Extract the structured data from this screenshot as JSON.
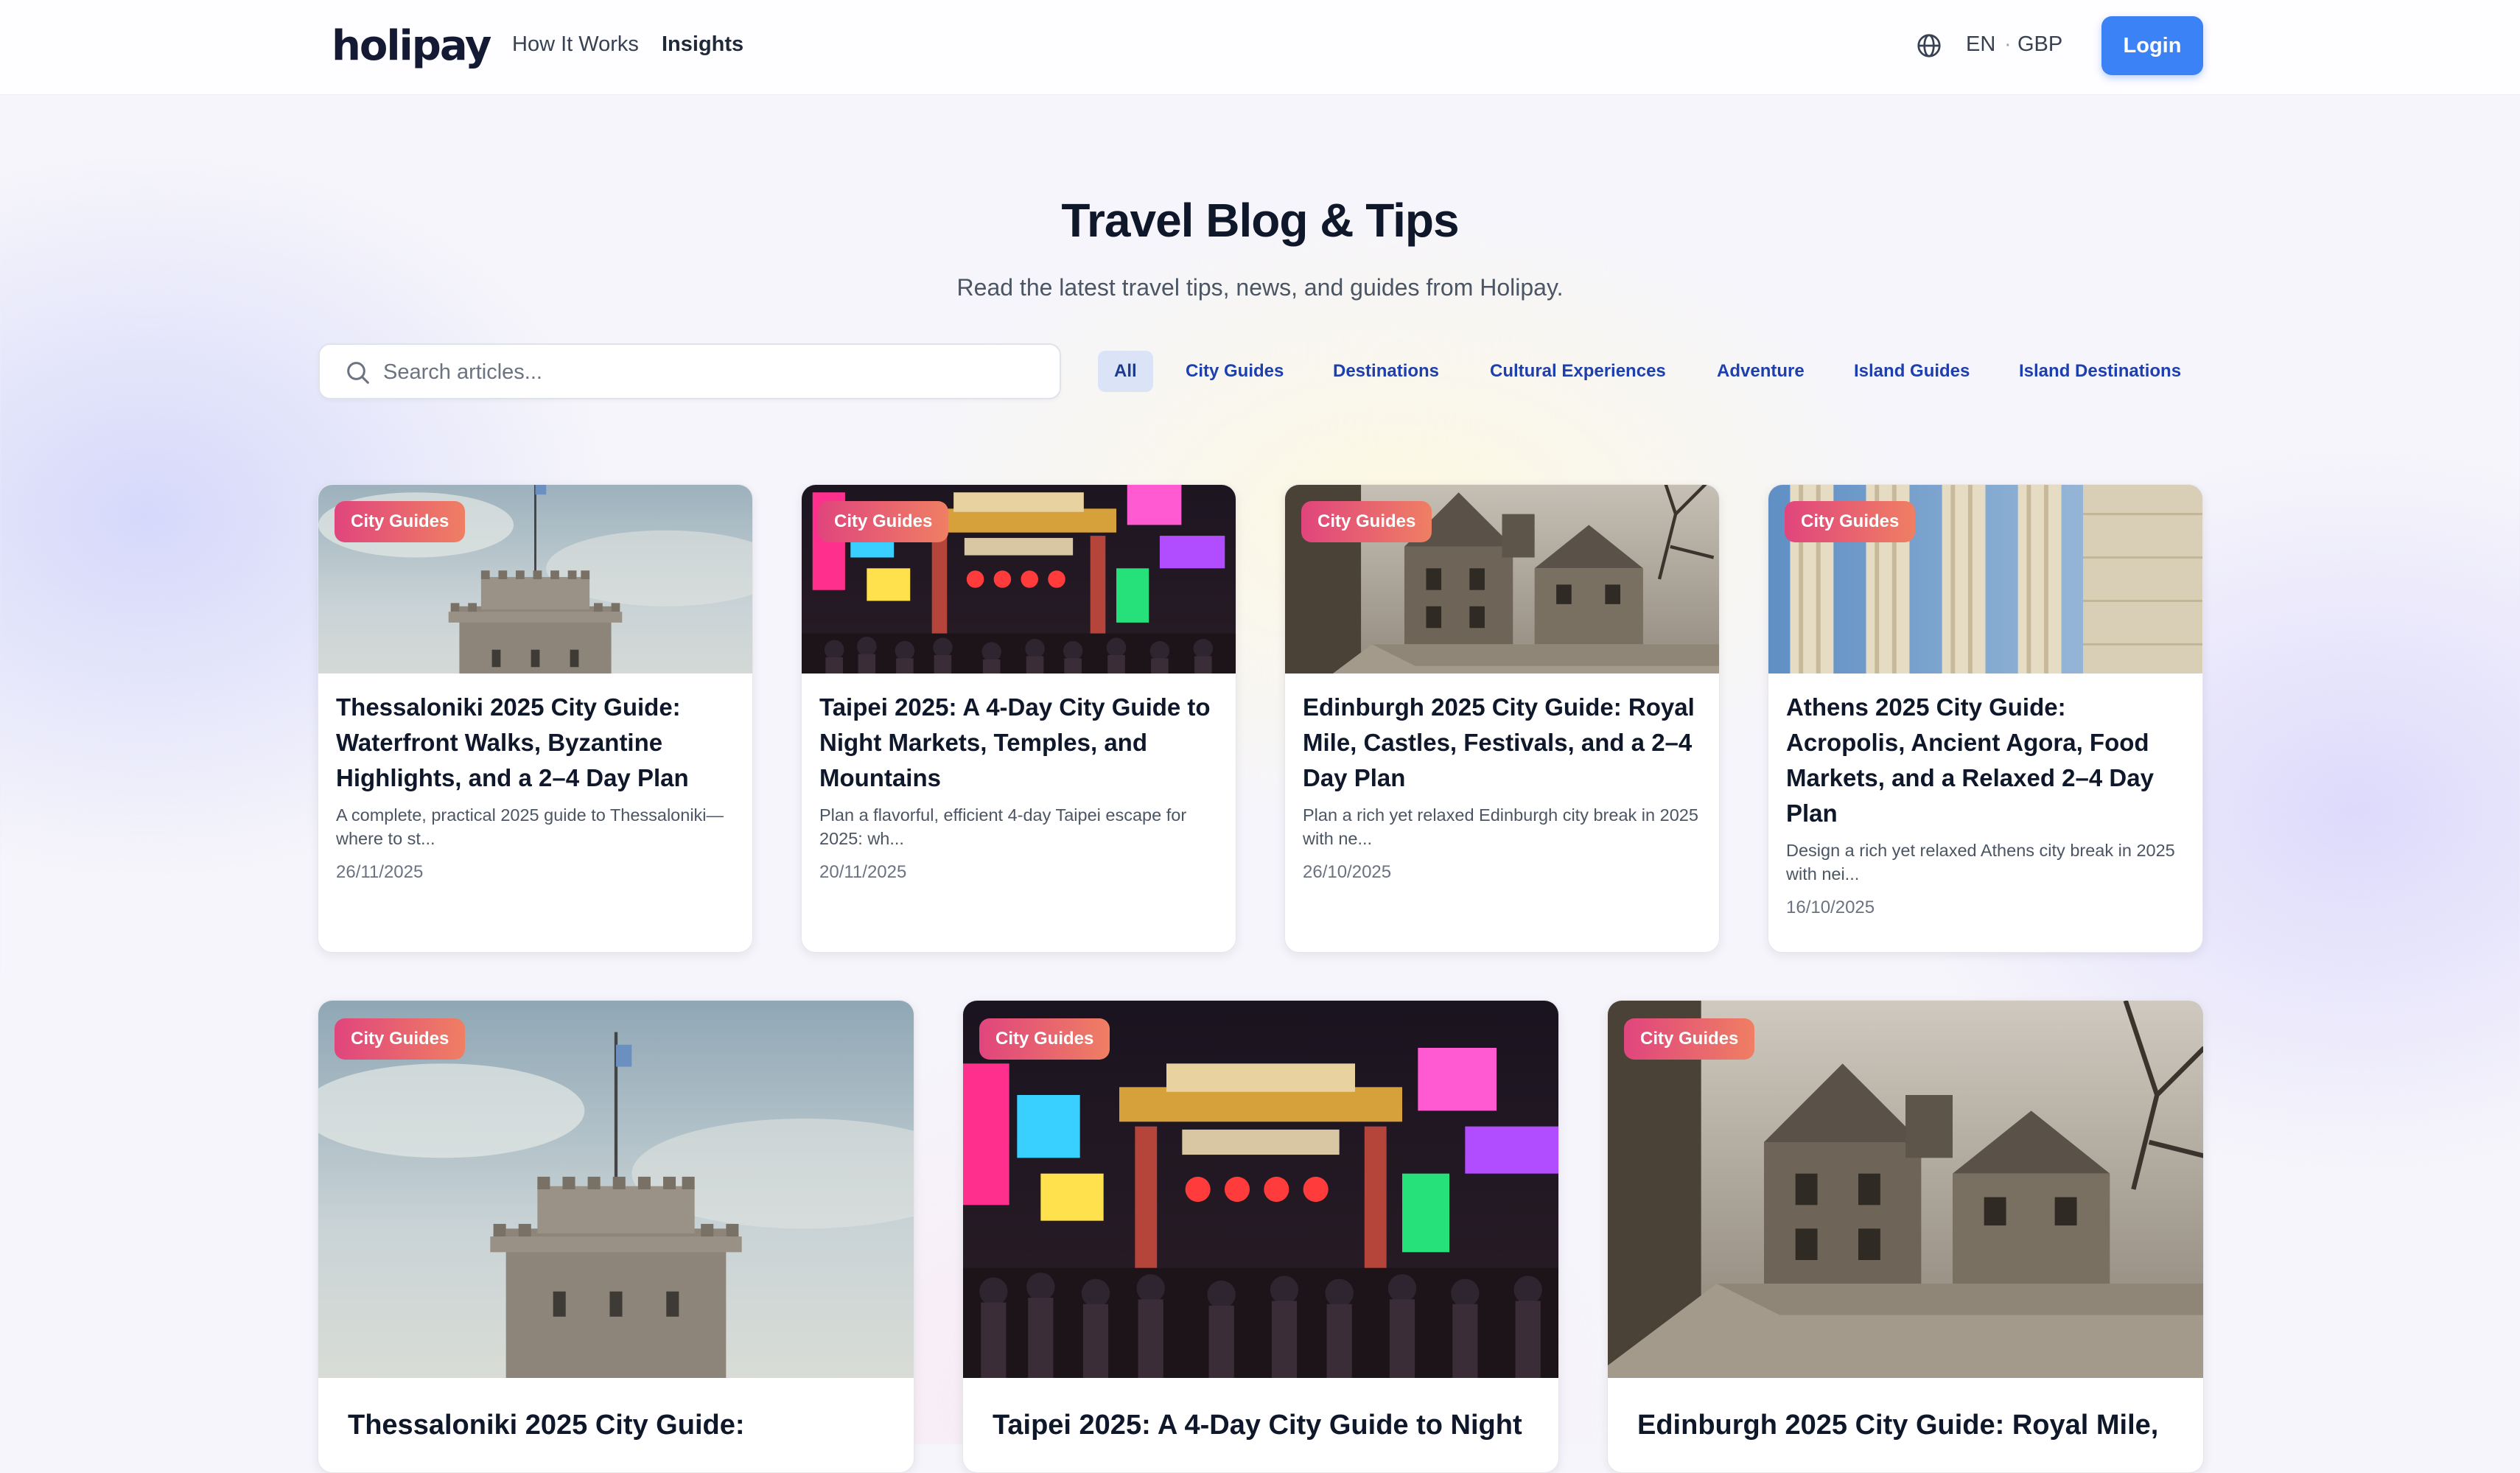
{
  "header": {
    "logo": "holipay",
    "nav": [
      "How It Works",
      "Insights"
    ],
    "lang": "EN",
    "separator": "·",
    "currency": "GBP",
    "login": "Login"
  },
  "hero": {
    "title": "Travel Blog & Tips",
    "subtitle": "Read the latest travel tips, news, and guides from Holipay."
  },
  "search": {
    "placeholder": "Search articles..."
  },
  "filters": [
    "All",
    "City Guides",
    "Destinations",
    "Cultural Experiences",
    "Adventure",
    "Island Guides",
    "Island Destinations"
  ],
  "colors": {
    "accent": "#3b82f6",
    "badge_start": "#e0457d",
    "badge_end": "#ef7f63",
    "chip_active": "#dbe4f7"
  },
  "articles": [
    {
      "category": "City Guides",
      "title": "Thessaloniki 2025 City Guide: Waterfront Walks, Byzantine Highlights, and a 2–4 Day Plan",
      "excerpt": "A complete, practical 2025 guide to Thessaloniki—where to st...",
      "date": "26/11/2025"
    },
    {
      "category": "City Guides",
      "title": "Taipei 2025: A 4-Day City Guide to Night Markets, Temples, and Mountains",
      "excerpt": "Plan a flavorful, efficient 4-day Taipei escape for 2025: wh...",
      "date": "20/11/2025"
    },
    {
      "category": "City Guides",
      "title": "Edinburgh 2025 City Guide: Royal Mile, Castles, Festivals, and a 2–4 Day Plan",
      "excerpt": "Plan a rich yet relaxed Edinburgh city break in 2025 with ne...",
      "date": "26/10/2025"
    },
    {
      "category": "City Guides",
      "title": "Athens 2025 City Guide: Acropolis, Ancient Agora, Food Markets, and a Relaxed 2–4 Day Plan",
      "excerpt": "Design a rich yet relaxed Athens city break in 2025 with nei...",
      "date": "16/10/2025"
    }
  ],
  "featured": [
    {
      "category": "City Guides",
      "title": "Thessaloniki 2025 City Guide:"
    },
    {
      "category": "City Guides",
      "title": "Taipei 2025: A 4-Day City Guide to Night"
    },
    {
      "category": "City Guides",
      "title": "Edinburgh 2025 City Guide: Royal Mile,"
    }
  ]
}
